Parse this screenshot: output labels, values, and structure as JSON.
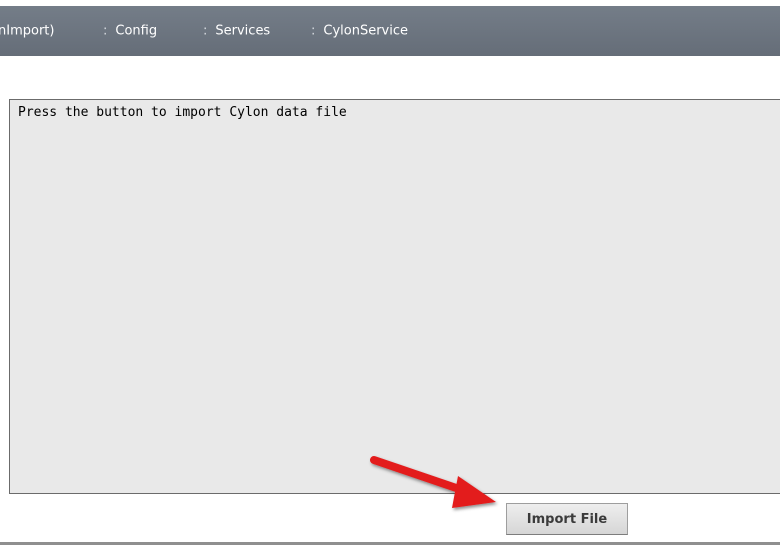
{
  "breadcrumb": {
    "items": [
      {
        "label": "nImport)",
        "separator": ""
      },
      {
        "label": "Config",
        "separator": ":"
      },
      {
        "label": "Services",
        "separator": ":"
      },
      {
        "label": "CylonService",
        "separator": ":"
      }
    ]
  },
  "output": {
    "text": "Press the button to import Cylon data file"
  },
  "actions": {
    "import_label": "Import File"
  },
  "annotation": {
    "arrow_icon": "red-arrow-icon",
    "arrow_color": "#e31b1b"
  },
  "colors": {
    "header_bar": "#6b737e",
    "text_area_bg": "#e9e9e9"
  }
}
